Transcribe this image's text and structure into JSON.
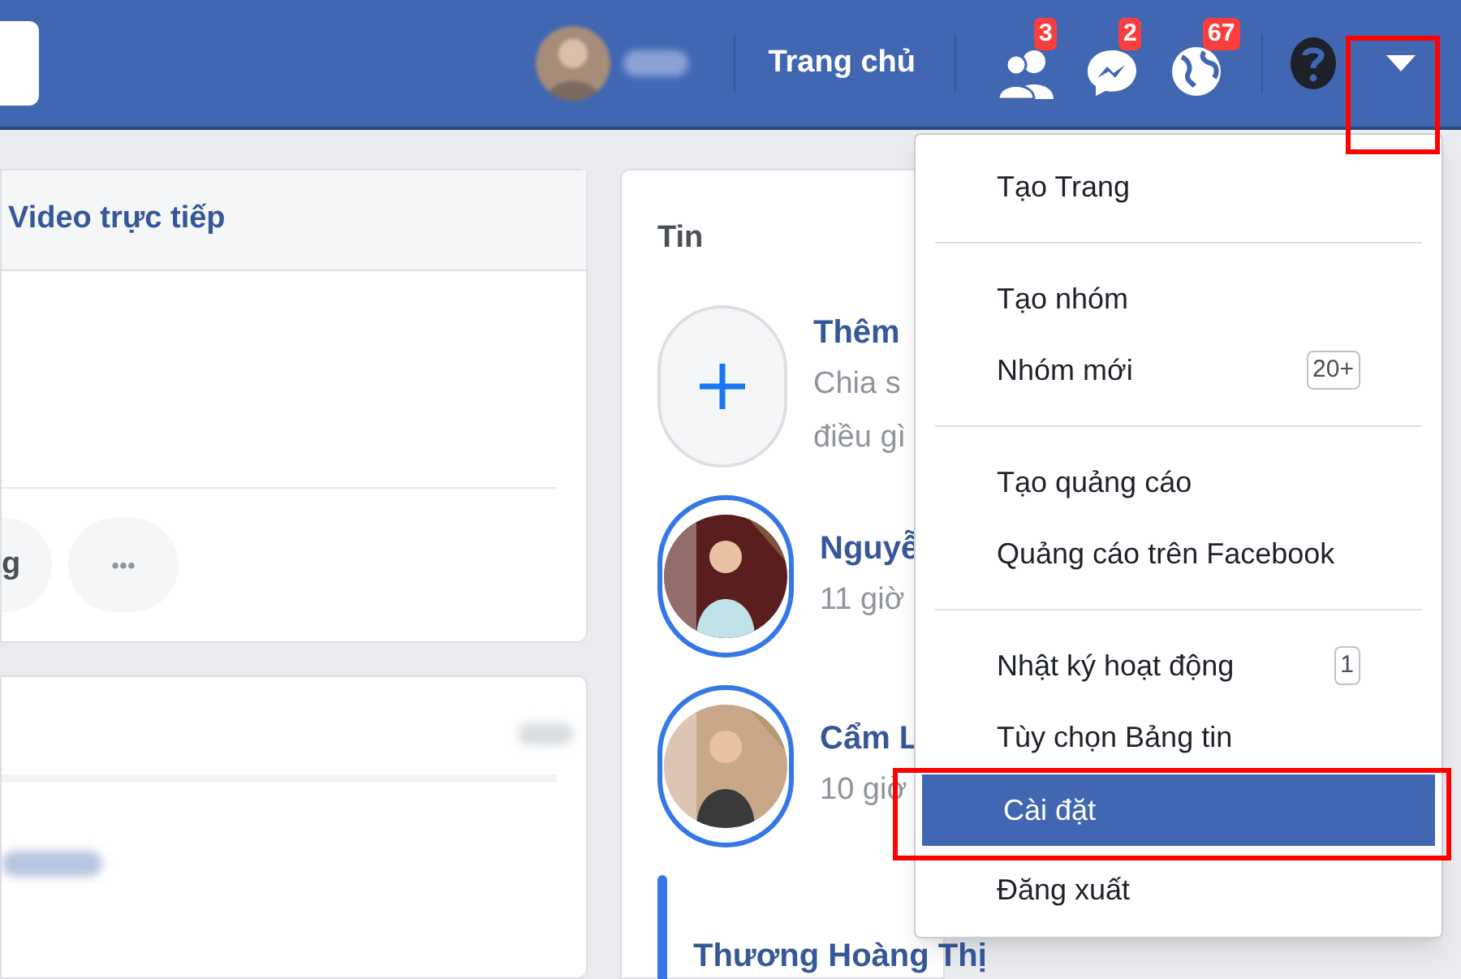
{
  "top_bar": {
    "home_link": "Trang chủ",
    "notifications": [
      {
        "kind": "friends",
        "count": "3"
      },
      {
        "kind": "messages",
        "count": "2"
      },
      {
        "kind": "globe",
        "count": "67"
      }
    ]
  },
  "composer": {
    "tab": "Video trực tiếp",
    "buttons": [
      {
        "kind": "label",
        "label": "g"
      },
      {
        "kind": "more",
        "label": "•••"
      }
    ]
  },
  "stories": {
    "title": "Tin",
    "items": [
      {
        "kind": "add",
        "name": "Thêm",
        "lines": [
          "Chia s",
          "điều gì"
        ]
      },
      {
        "kind": "story",
        "name": "Nguyễ",
        "lines": [
          "11 giờ"
        ]
      },
      {
        "kind": "story",
        "name": "Cẩm L",
        "lines": [
          "10 giờ"
        ]
      },
      {
        "kind": "story",
        "name": "Thương Hoàng Thị"
      }
    ]
  },
  "menu": {
    "groups": [
      [
        {
          "label": "Tạo Trang",
          "selected": false
        }
      ],
      [
        {
          "label": "Tạo nhóm",
          "selected": false
        },
        {
          "label": "Nhóm mới",
          "badge": "20+",
          "selected": false
        }
      ],
      [
        {
          "label": "Tạo quảng cáo",
          "selected": false
        },
        {
          "label": "Quảng cáo trên Facebook",
          "selected": false
        }
      ],
      [
        {
          "label": "Nhật ký hoạt động",
          "badge": "1",
          "selected": false
        },
        {
          "label": "Tùy chọn Bảng tin",
          "selected": false
        },
        {
          "label": "Cài đặt",
          "selected": true
        },
        {
          "label": "Đăng xuất",
          "selected": false
        }
      ]
    ]
  }
}
